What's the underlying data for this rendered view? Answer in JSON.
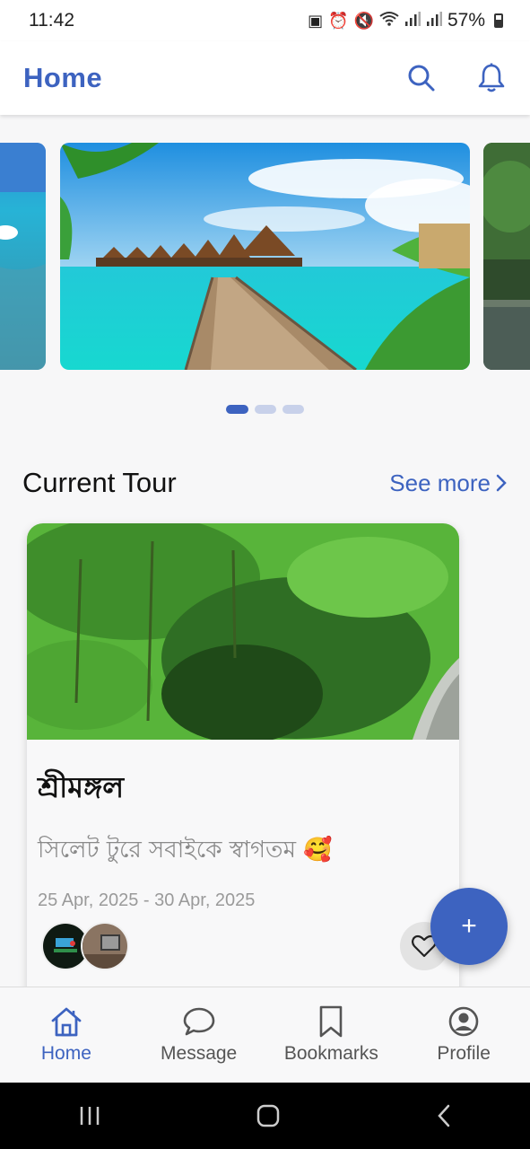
{
  "status_bar": {
    "time": "11:42",
    "battery": "57%"
  },
  "app_bar": {
    "title": "Home",
    "search_icon": "search-icon",
    "notification_icon": "bell-icon"
  },
  "carousel": {
    "slides": 3,
    "active_index": 0
  },
  "current_tour": {
    "title": "Current Tour",
    "see_more": "See more",
    "card": {
      "name": "শ্রীমঙ্গল",
      "subtitle": "সিলেট টুরে সবাইকে স্বাগতম 🥰",
      "dates": "25 Apr, 2025 - 30 Apr, 2025"
    }
  },
  "fab": {
    "label": "+"
  },
  "bottom_nav": {
    "items": [
      {
        "label": "Home",
        "icon": "home-icon",
        "active": true
      },
      {
        "label": "Message",
        "icon": "message-icon",
        "active": false
      },
      {
        "label": "Bookmarks",
        "icon": "bookmark-icon",
        "active": false
      },
      {
        "label": "Profile",
        "icon": "profile-icon",
        "active": false
      }
    ]
  },
  "colors": {
    "accent": "#3d63c0",
    "background": "#f7f7f8"
  }
}
